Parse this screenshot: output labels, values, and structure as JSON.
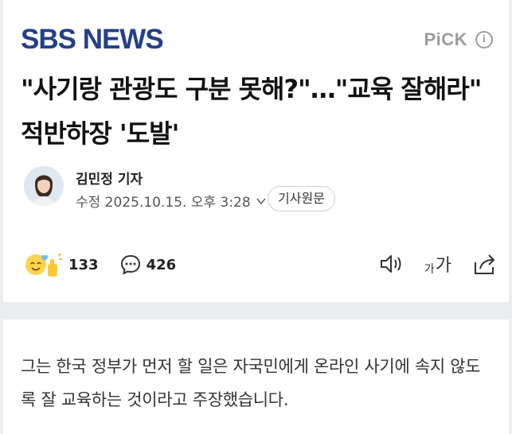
{
  "header": {
    "brand": "SBS NEWS",
    "pick_label": "PiCK",
    "info_icon": "info-icon"
  },
  "article": {
    "headline": "\"사기랑 관광도 구분 못해?\"…\"교육 잘해라\" 적반하장 '도발'",
    "author": "김민정 기자",
    "modified": "수정 2025.10.15. 오후 3:28",
    "original_button": "기사원문",
    "reaction_count": "133",
    "comment_count": "426",
    "font_tool_small": "가",
    "font_tool_large": "가",
    "body": "그는 한국 정부가 먼저 할 일은 자국민에게 온라인 사기에 속지 않도록 잘 교육하는 것이라고 주장했습니다."
  },
  "colors": {
    "brand": "#243f8a",
    "page_bg": "#ebedf0",
    "card_bg": "#ffffff"
  }
}
